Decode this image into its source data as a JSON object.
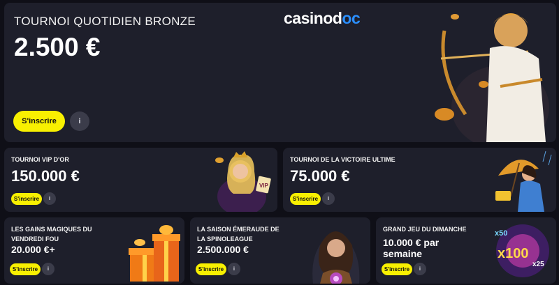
{
  "brand": {
    "logo_text_a": "casinod",
    "logo_text_b": "oc"
  },
  "hero": {
    "title": "TOURNOI QUOTIDIEN BRONZE",
    "amount": "2.500 €",
    "cta": "S'inscrire",
    "info": "i"
  },
  "cards": [
    {
      "title": "TOURNOI VIP D'OR",
      "amount": "150.000 €",
      "cta": "S'inscrire",
      "info": "i"
    },
    {
      "title": "TOURNOI DE LA VICTOIRE ULTIME",
      "amount": "75.000 €",
      "cta": "S'inscrire",
      "info": "i"
    },
    {
      "title": "LES GAINS MAGIQUES DU VENDREDI FOU",
      "amount": "20.000 €+",
      "cta": "S'inscrire",
      "info": "i"
    },
    {
      "title": "LA SAISON ÉMERAUDE DE LA SPINOLEAGUE",
      "amount": "2.500.000 €",
      "cta": "S'inscrire",
      "info": "i"
    },
    {
      "title": "GRAND JEU DU DIMANCHE",
      "amount": "10.000 € par semaine",
      "cta": "S'inscrire",
      "info": "i"
    }
  ],
  "art_text": {
    "vip": "VIP",
    "mult_50": "x50",
    "mult_100": "x100",
    "mult_25": "x25"
  },
  "colors": {
    "accent": "#f8f001",
    "card_bg": "#1e1f2b",
    "page_bg": "#0f0f17",
    "logo_accent": "#2b8fff"
  },
  "icons": [
    "archer-hero-illustration",
    "vip-queen-illustration",
    "umbrella-lady-illustration",
    "gift-boxes-illustration",
    "emerald-witch-illustration",
    "multiplier-burst-illustration",
    "info-icon"
  ]
}
